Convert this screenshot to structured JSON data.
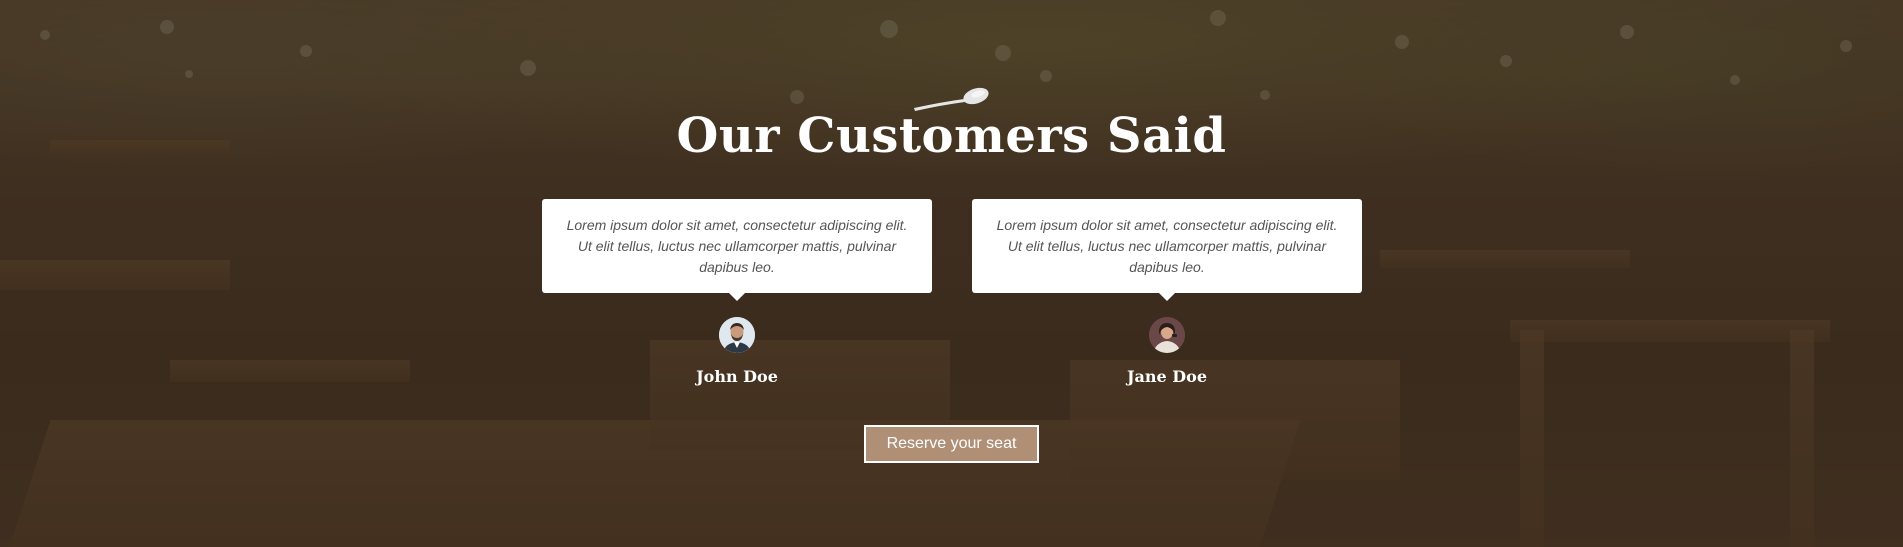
{
  "section": {
    "title": "Our Customers Said",
    "icon": "spoon-icon"
  },
  "testimonials": [
    {
      "quote": "Lorem ipsum dolor sit amet, consectetur adipiscing elit. Ut elit tellus, luctus nec ullamcorper mattis, pulvinar dapibus leo.",
      "name": "John Doe"
    },
    {
      "quote": "Lorem ipsum dolor sit amet, consectetur adipiscing elit. Ut elit tellus, luctus nec ullamcorper mattis, pulvinar dapibus leo.",
      "name": "Jane Doe"
    }
  ],
  "cta": {
    "label": "Reserve your seat"
  },
  "colors": {
    "button_background": "#b08f77",
    "overlay": "#372a1f",
    "card_background": "#ffffff",
    "title_text": "#ffffff"
  }
}
